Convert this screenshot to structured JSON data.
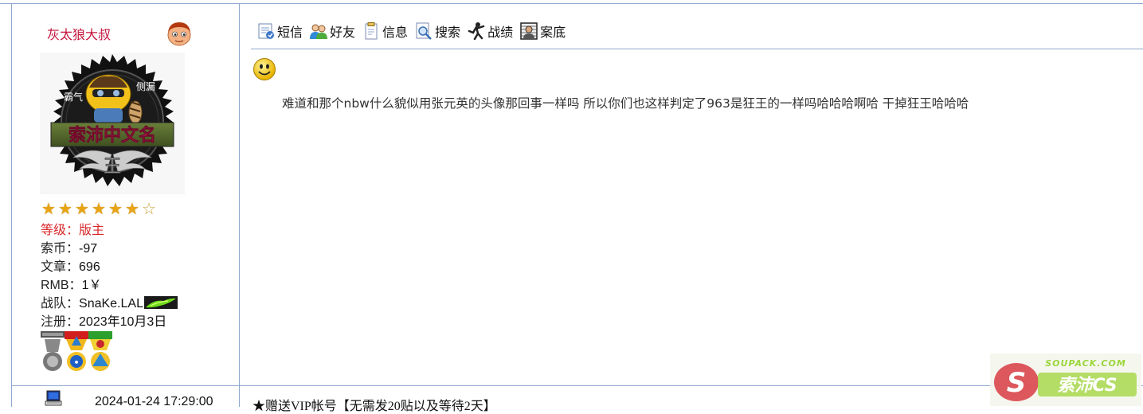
{
  "user": {
    "name": "灰太狼大叔",
    "avatar_text": {
      "badge_left": "霸气",
      "badge_right": "侧漏",
      "banner": "索沛中文名",
      "emblem": "王"
    },
    "stars": {
      "filled": 6,
      "total": 7
    },
    "level": {
      "label": "等级：",
      "value": "版主"
    },
    "coins": {
      "label": "索币：",
      "value": "-97"
    },
    "posts": {
      "label": "文章：",
      "value": "696"
    },
    "rmb": {
      "label": "RMB：",
      "value": "1￥"
    },
    "team": {
      "label": "战队：",
      "value": "SnaKe.LAL"
    },
    "registered": {
      "label": "注册：",
      "value": "2023年10月3日"
    }
  },
  "toolbar": {
    "sms": "短信",
    "friends": "好友",
    "info": "信息",
    "search": "搜索",
    "stats": "战绩",
    "record": "案底"
  },
  "post": {
    "body": "难道和那个nbw什么貌似用张元英的头像那回事一样吗  所以你们也这样判定了963是狂王的一样吗哈哈哈啊哈 干掉狂王哈哈哈"
  },
  "footer": {
    "time": "2024-01-24 17:29:00",
    "vip": "★赠送VIP帐号【无需发20贴以及等待2天】"
  },
  "watermark": {
    "site": "SOUPACK.COM",
    "brand": "索沛CS"
  },
  "colors": {
    "username": "#c4143c",
    "border": "#8fa8cf",
    "level": "#d9282b"
  }
}
